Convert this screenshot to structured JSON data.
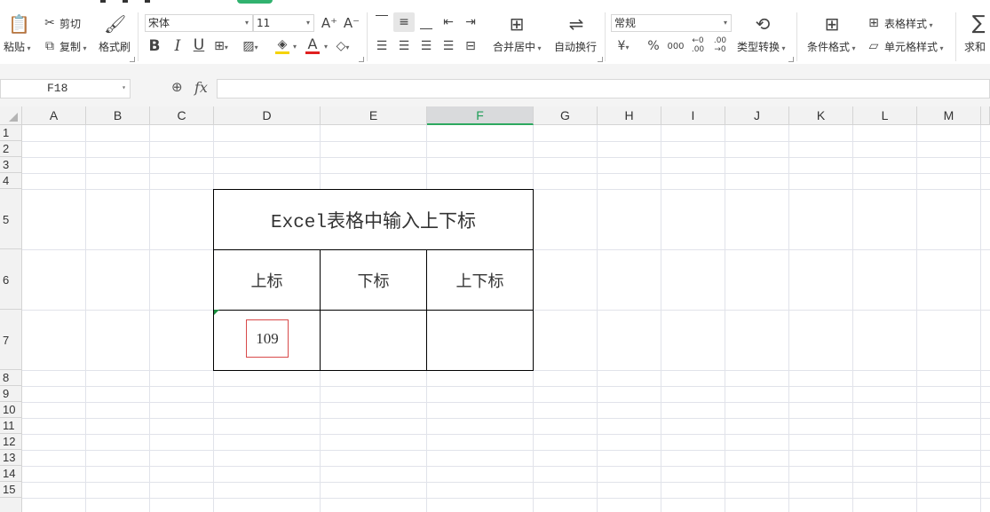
{
  "ribbon": {
    "clipboard": {
      "paste": "粘贴",
      "cut": "剪切",
      "copy": "复制",
      "format_painter": "格式刷"
    },
    "font": {
      "name": "宋体",
      "size": "11",
      "grow_icon": "A⁺",
      "shrink_icon": "A⁻",
      "bold": "B",
      "italic": "I",
      "underline": "U",
      "font_color": "A"
    },
    "alignment": {
      "merge_center": "合并居中",
      "wrap_text": "自动换行"
    },
    "number": {
      "format": "常规",
      "currency": "¥",
      "percent": "%",
      "thousands": "000",
      "inc_decimal": "←0 .00",
      "dec_decimal": ".00 →0",
      "type_convert": "类型转换"
    },
    "styles": {
      "conditional_format": "条件格式",
      "table_style": "表格样式",
      "cell_style": "单元格样式"
    },
    "editing": {
      "sum": "求和"
    },
    "accent_colors": {
      "highlight": "#f5d300",
      "font_color": "#e02020",
      "tab_active": "#31b26f"
    }
  },
  "formula_bar": {
    "cell_ref": "F18",
    "fx": "fx",
    "formula": ""
  },
  "grid": {
    "columns": [
      "A",
      "B",
      "C",
      "D",
      "E",
      "F",
      "G",
      "H",
      "I",
      "J",
      "K",
      "L",
      "M"
    ],
    "active_column": "F",
    "rows": [
      "1",
      "2",
      "3",
      "4",
      "5",
      "6",
      "7",
      "8",
      "9",
      "10",
      "11",
      "12",
      "13",
      "14",
      "15"
    ]
  },
  "table": {
    "title": "Excel表格中输入上下标",
    "headers": [
      "上标",
      "下标",
      "上下标"
    ],
    "values": [
      "109",
      "",
      ""
    ]
  }
}
